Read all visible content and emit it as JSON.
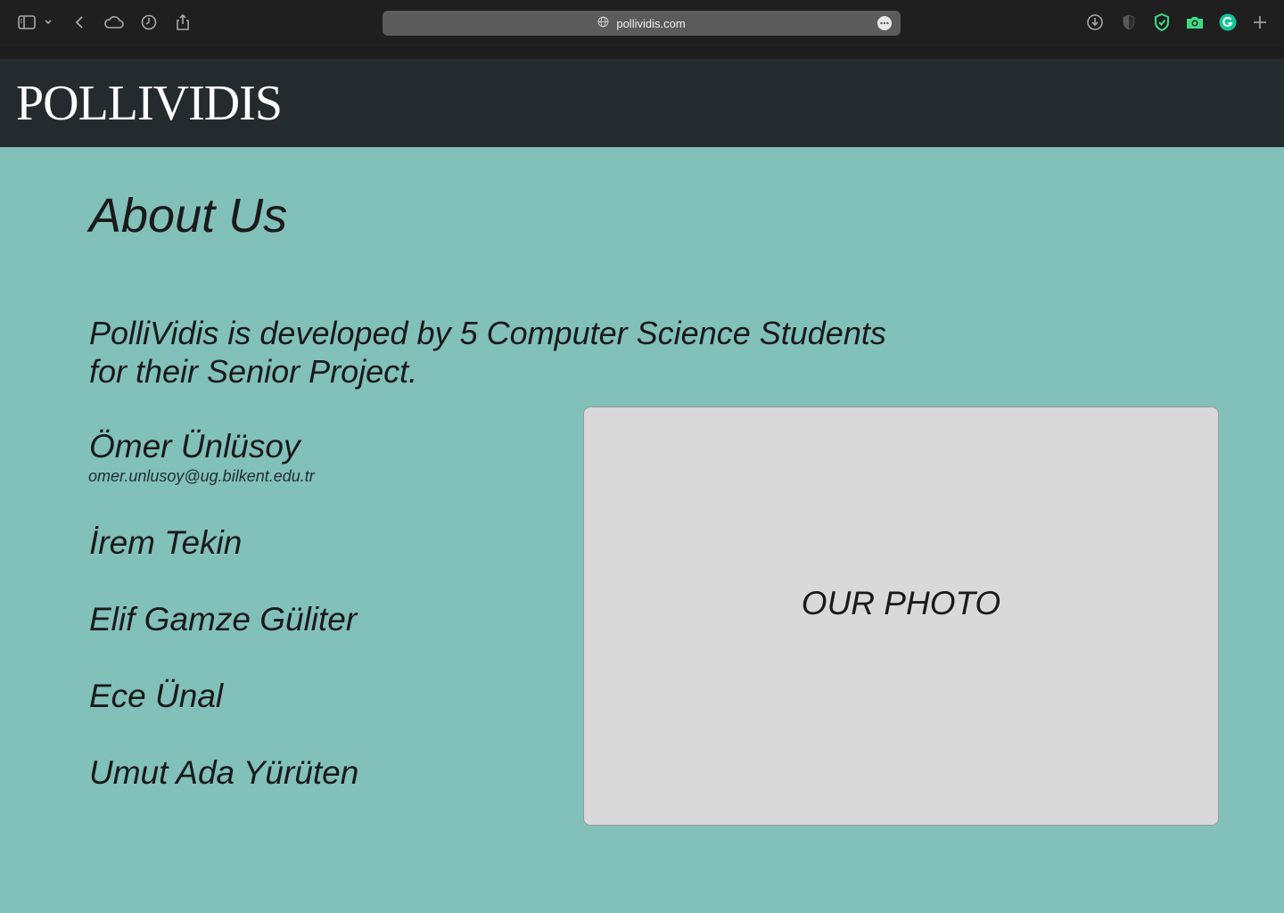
{
  "browser": {
    "url": "pollividis.com",
    "icons": [
      "sidebar-icon",
      "chevron-down-icon",
      "back-icon",
      "cloud-icon",
      "history-icon",
      "share-icon",
      "globe-icon",
      "more-icon",
      "download-icon",
      "shield-icon",
      "shield-check-icon",
      "camera-icon",
      "grammarly-icon",
      "plus-icon"
    ]
  },
  "header": {
    "logo": "POLLIVIDIS"
  },
  "main": {
    "title": "About Us",
    "intro_line1": "PolliVidis is developed by 5 Computer Science Students",
    "intro_line2": "for their Senior Project.",
    "members": [
      {
        "name": "Ömer Ünlüsoy",
        "email": "omer.unlusoy@ug.bilkent.edu.tr"
      },
      {
        "name": "İrem Tekin"
      },
      {
        "name": "Elif Gamze Güliter"
      },
      {
        "name": "Ece Ünal"
      },
      {
        "name": "Umut Ada Yürüten"
      }
    ],
    "photo_label": "OUR PHOTO"
  },
  "colors": {
    "page_bg": "#82c0ba",
    "header_bg": "#242b2e",
    "photo_bg": "#d9d9d9",
    "accent_green": "#3ddc84"
  }
}
